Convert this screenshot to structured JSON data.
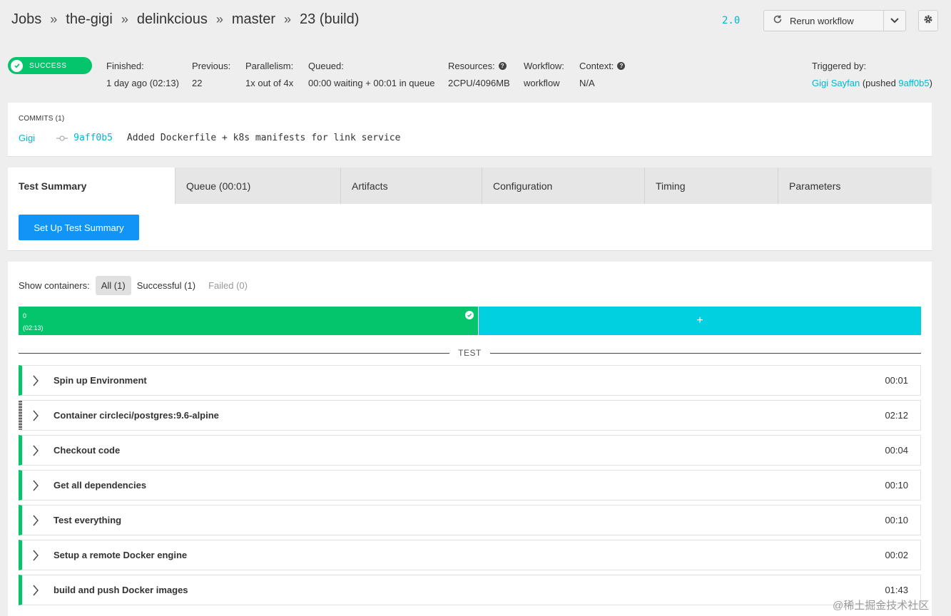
{
  "breadcrumb": [
    {
      "label": "Jobs"
    },
    {
      "label": "the-gigi"
    },
    {
      "label": "delinkcious"
    },
    {
      "label": "master"
    },
    {
      "label": "23 (build)"
    }
  ],
  "breadcrumb_separator": "»",
  "header": {
    "version": "2.0",
    "rerun_label": "Rerun workflow",
    "rerun_icon": "refresh-icon",
    "caret_icon": "chevron-down-icon",
    "settings_icon": "gear-icon"
  },
  "status": {
    "label": "SUCCESS",
    "color": "#04c46c"
  },
  "meta": {
    "finished": {
      "label": "Finished:",
      "value": "1 day ago (02:13)"
    },
    "previous": {
      "label": "Previous:",
      "value": "22"
    },
    "parallelism": {
      "label": "Parallelism:",
      "value": "1x out of 4x"
    },
    "queued": {
      "label": "Queued:",
      "value": "00:00 waiting + 00:01 in queue"
    },
    "resources": {
      "label": "Resources:",
      "value": "2CPU/4096MB"
    },
    "workflow": {
      "label": "Workflow:",
      "value": "workflow"
    },
    "context": {
      "label": "Context:",
      "value": "N/A"
    },
    "triggered": {
      "label": "Triggered by:",
      "user": "Gigi Sayfan",
      "pushed_prefix": "(pushed ",
      "commit": "9aff0b5",
      "pushed_suffix": ")"
    }
  },
  "commits": {
    "title": "COMMITS (1)",
    "author": "Gigi",
    "hash": "9aff0b5",
    "message": "Added Dockerfile + k8s manifests for link service"
  },
  "tabs": [
    {
      "label": "Test Summary",
      "active": true
    },
    {
      "label": "Queue (00:01)"
    },
    {
      "label": "Artifacts"
    },
    {
      "label": "Configuration"
    },
    {
      "label": "Timing"
    },
    {
      "label": "Parameters"
    }
  ],
  "setup_button": "Set Up Test Summary",
  "containers": {
    "show_label": "Show containers:",
    "filters": [
      {
        "label": "All (1)",
        "selected": true
      },
      {
        "label": "Successful (1)"
      },
      {
        "label": "Failed (0)",
        "disabled": true
      }
    ],
    "container_index": "0",
    "container_time": "(02:13)",
    "add_label": "+",
    "section_title": "TEST"
  },
  "steps": [
    {
      "name": "Spin up Environment",
      "duration": "00:01",
      "status": "success"
    },
    {
      "name": "Container circleci/postgres:9.6-alpine",
      "duration": "02:12",
      "status": "running"
    },
    {
      "name": "Checkout code",
      "duration": "00:04",
      "status": "success"
    },
    {
      "name": "Get all dependencies",
      "duration": "00:10",
      "status": "success"
    },
    {
      "name": "Test everything",
      "duration": "00:10",
      "status": "success"
    },
    {
      "name": "Setup a remote Docker engine",
      "duration": "00:02",
      "status": "success"
    },
    {
      "name": "build and push Docker images",
      "duration": "01:43",
      "status": "success"
    }
  ],
  "colors": {
    "accent": "#00b7d4",
    "success": "#04c46c",
    "primary_button": "#1194f5",
    "container_bar": "#00d0e0"
  },
  "watermark": "@稀土掘金技术社区"
}
